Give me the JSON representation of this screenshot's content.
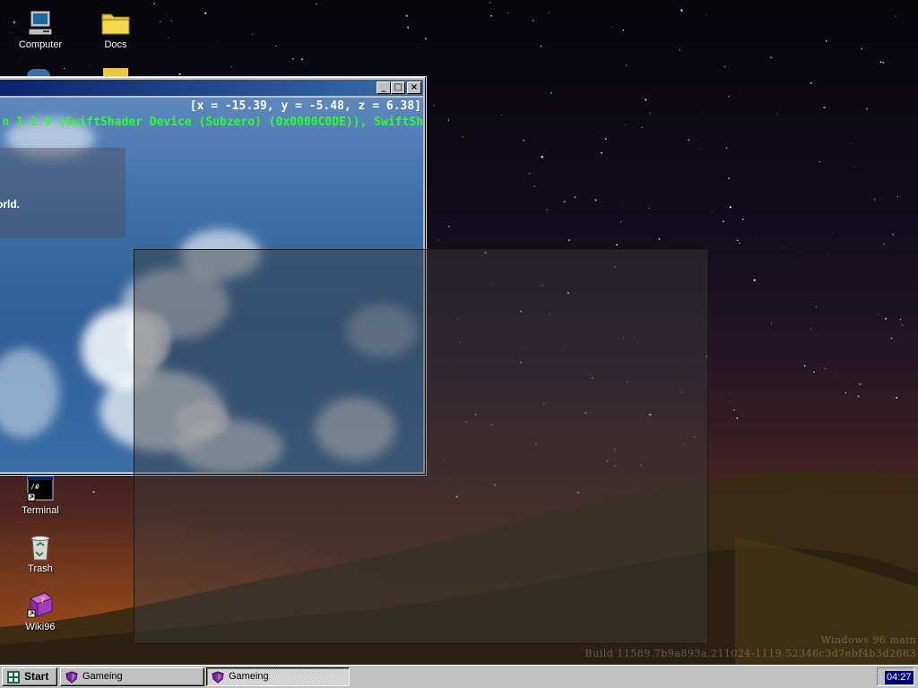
{
  "desktop": {
    "icons": [
      {
        "label": "Computer",
        "icon": "computer-icon"
      },
      {
        "label": "Docs",
        "icon": "folder-icon"
      },
      {
        "label": "Terminal",
        "icon": "terminal-icon"
      },
      {
        "label": "Trash",
        "icon": "recycle-bin-icon"
      },
      {
        "label": "Wiki96",
        "icon": "help-book-icon"
      }
    ],
    "watermark": {
      "line1": "Windows 96 main",
      "line2": "Build 11589.7b9a893a.211024-1119.52346c3d7ebf4b3d2683"
    }
  },
  "window": {
    "title": "",
    "controls": {
      "minimize": "_",
      "maximize": "□",
      "close": "×"
    },
    "coords": "[x = -15.39, y = -5.48, z = 6.38]",
    "gl_info": "n 1.2.0 (SwiftShader Device (Subzero) (0x0000C0DE)), SwiftSh",
    "hello_text": "orld."
  },
  "taskbar": {
    "start_label": "Start",
    "tasks": [
      {
        "label": "Gameing",
        "pressed": false
      },
      {
        "label": "Gameing",
        "pressed": true
      }
    ],
    "clock": "04:27"
  },
  "colors": {
    "titlebar": "#0a246a",
    "overlay_text": "#2aff2a",
    "taskbar": "#c0c0c0",
    "clock_bg": "#000080"
  }
}
